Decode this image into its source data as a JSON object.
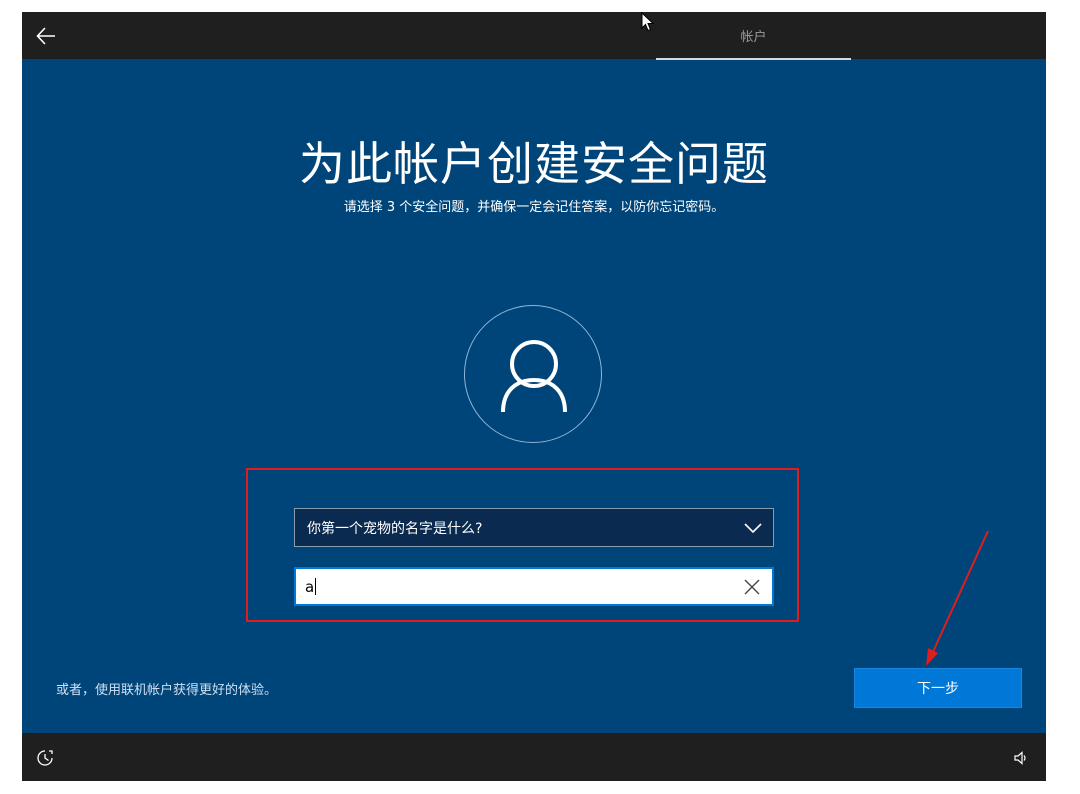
{
  "topbar": {
    "tab_label": "帐户"
  },
  "main": {
    "title": "为此帐户创建安全问题",
    "subtitle": "请选择 3 个安全问题，并确保一定会记住答案，以防你忘记密码。",
    "question_selected": "你第一个宠物的名字是什么?",
    "answer_value": "a",
    "online_account_link": "或者，使用联机帐户获得更好的体验。",
    "next_label": "下一步"
  },
  "colors": {
    "background": "#00457a",
    "bar": "#1f1f1f",
    "accent": "#0078d7",
    "annotation": "#e01d1d"
  },
  "icons": {
    "back": "back-arrow-icon",
    "avatar": "user-icon",
    "dropdown": "chevron-down-icon",
    "clear": "close-icon",
    "accessibility": "ease-of-access-icon",
    "volume": "volume-icon"
  }
}
